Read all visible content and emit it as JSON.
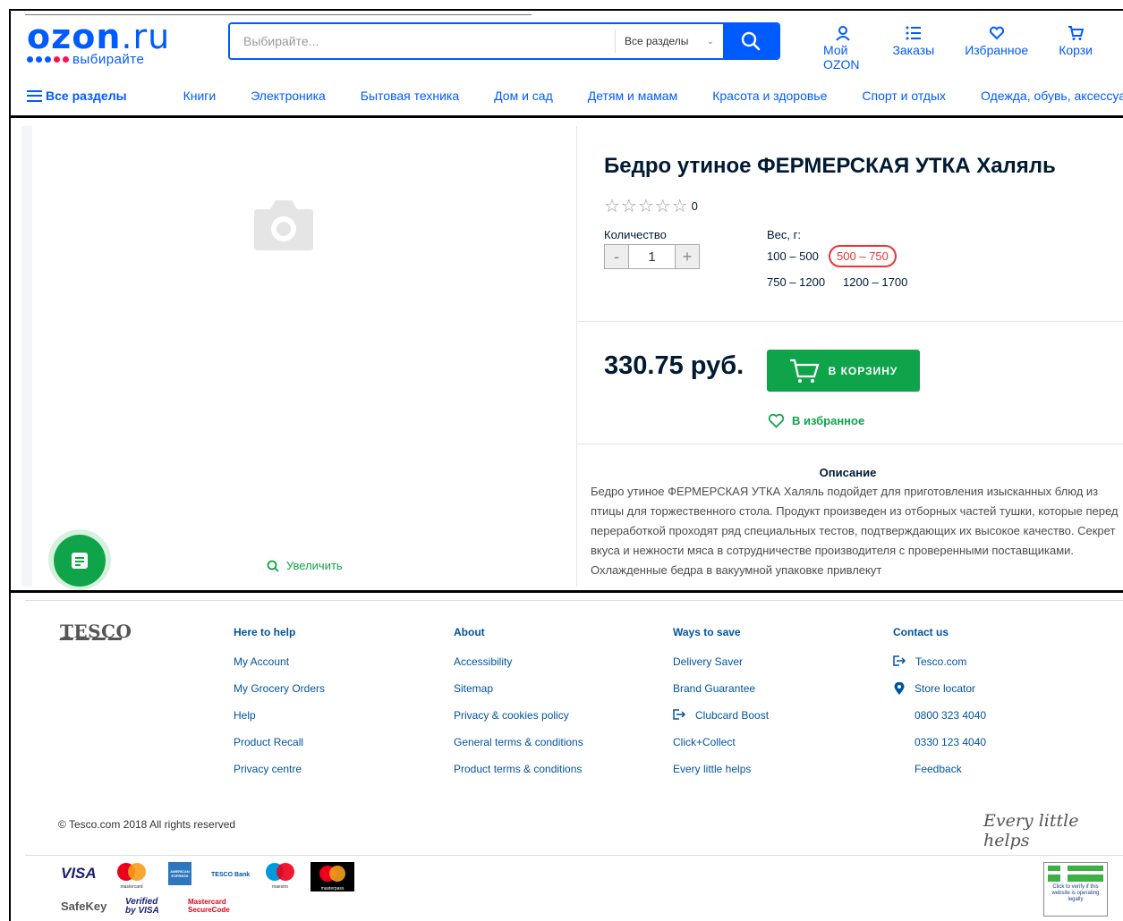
{
  "ozon": {
    "logo_text": "ozon",
    "logo_ru": ".ru",
    "logo_sub": "выбирайте",
    "search": {
      "placeholder": "Выбирайте...",
      "category": "Все разделы"
    },
    "header_links": [
      {
        "label": "Мой OZON",
        "icon": "user-icon"
      },
      {
        "label": "Заказы",
        "icon": "list-icon"
      },
      {
        "label": "Избранное",
        "icon": "heart-icon"
      },
      {
        "label": "Корзи",
        "icon": "cart-icon"
      }
    ],
    "nav_all": "Все разделы",
    "nav": [
      "Книги",
      "Электроника",
      "Бытовая техника",
      "Дом и сад",
      "Детям и мамам",
      "Красота и здоровье",
      "Спорт и отдых",
      "Одежда, обувь, аксессуар"
    ]
  },
  "product": {
    "title": "Бедро утиное ФЕРМЕРСКАЯ УТКА Халяль",
    "rating_count": "0",
    "rating_stars": 0,
    "quantity_label": "Количество",
    "quantity": "1",
    "minus": "-",
    "plus": "+",
    "weight_label": "Вес, г:",
    "weights": [
      "100 – 500",
      "500 – 750",
      "750 – 1200",
      "1200 – 1700"
    ],
    "selected_weight": "500 – 750",
    "price": "330.75 руб.",
    "cart_button": "В КОРЗИНУ",
    "favorite": "В избранное",
    "zoom": "Увеличить",
    "description_title": "Описание",
    "description": "Бедро утиное ФЕРМЕРСКАЯ УТКА Халяль подойдет для приготовления изысканных блюд из птицы для торжественного стола. Продукт произведен из отборных частей тушки, которые перед переработкой проходят ряд специальных тестов, подтверждающих их высокое качество. Секрет вкуса и нежности мяса в сотрудничестве производителя с проверенными поставщиками. Охлажденные бедра в вакуумной упаковке привлекут"
  },
  "tesco": {
    "logo": "TESCO",
    "columns": [
      {
        "title": "Here to help",
        "links": [
          {
            "label": "My Account"
          },
          {
            "label": "My Grocery Orders"
          },
          {
            "label": "Help"
          },
          {
            "label": "Product Recall"
          },
          {
            "label": "Privacy centre"
          }
        ]
      },
      {
        "title": "About",
        "links": [
          {
            "label": "Accessibility"
          },
          {
            "label": "Sitemap"
          },
          {
            "label": "Privacy & cookies policy"
          },
          {
            "label": "General terms & conditions"
          },
          {
            "label": "Product terms & conditions"
          }
        ]
      },
      {
        "title": "Ways to save",
        "links": [
          {
            "label": "Delivery Saver"
          },
          {
            "label": "Brand Guarantee"
          },
          {
            "label": "Clubcard Boost",
            "icon": "external-link-icon"
          },
          {
            "label": "Click+Collect"
          },
          {
            "label": "Every little helps"
          }
        ]
      },
      {
        "title": "Contact us",
        "links": [
          {
            "label": "Tesco.com",
            "icon": "external-link-icon"
          },
          {
            "label": "Store locator",
            "icon": "location-pin-icon"
          },
          {
            "label": "0800 323 4040"
          },
          {
            "label": "0330 123 4040"
          },
          {
            "label": "Feedback"
          }
        ]
      }
    ],
    "copyright": "© Tesco.com 2018 All rights reserved",
    "tagline": "Every little helps",
    "payments": [
      "VISA",
      "mastercard",
      "AMERICAN EXPRESS",
      "TESCO Bank",
      "maestro",
      "masterpass",
      "SafeKey",
      "Verified by VISA",
      "Mastercard SecureCode"
    ],
    "verify_text": "Click to verify if this website is operating legally"
  }
}
